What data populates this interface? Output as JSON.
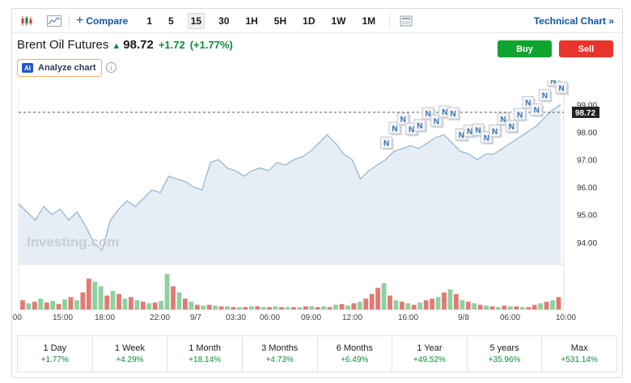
{
  "toolbar": {
    "compare_label": "Compare",
    "intervals": [
      "1",
      "5",
      "15",
      "30",
      "1H",
      "5H",
      "1D",
      "1W",
      "1M"
    ],
    "active_interval": "15",
    "technical_chart_label": "Technical Chart »"
  },
  "instrument": {
    "name": "Brent Oil Futures",
    "price": "98.72",
    "change": "+1.72",
    "change_pct": "(+1.77%)",
    "direction": "up"
  },
  "actions": {
    "buy_label": "Buy",
    "sell_label": "Sell"
  },
  "analyze": {
    "badge": "AI",
    "label": "Analyze chart",
    "info": "i"
  },
  "colors": {
    "up": "#0e8a3a",
    "buy": "#0fa430",
    "sell": "#e8352b",
    "link": "#1256a0",
    "line": "#8fb3d1",
    "area": "#e3ecf4"
  },
  "chart_data": {
    "type": "area",
    "y_ticks": [
      "99.00",
      "98.00",
      "97.00",
      "96.00",
      "95.00",
      "94.00"
    ],
    "ylim": [
      93.2,
      99.6
    ],
    "current_price_label": "98.72",
    "current_price": 98.72,
    "x_ticks": [
      ":00",
      "15:00",
      "18:00",
      "22:00",
      "9/7",
      "03:30",
      "06:00",
      "09:00",
      "12:00",
      "16:00",
      "9/8",
      "06:00",
      "10:00"
    ],
    "watermark": "Investing.com",
    "news_marker_label": "N",
    "news_marker_count": 22,
    "price_series": [
      95.4,
      95.1,
      94.8,
      95.3,
      95.0,
      95.2,
      94.8,
      95.1,
      94.6,
      94.0,
      93.7,
      94.8,
      95.2,
      95.5,
      95.3,
      95.6,
      95.9,
      95.8,
      96.4,
      96.3,
      96.2,
      96.0,
      95.9,
      96.9,
      97.0,
      96.7,
      96.6,
      96.4,
      96.6,
      96.7,
      96.6,
      96.9,
      96.8,
      97.0,
      97.1,
      97.3,
      97.6,
      97.9,
      97.6,
      97.2,
      97.0,
      96.3,
      96.6,
      96.8,
      97.0,
      97.3,
      97.4,
      97.5,
      97.4,
      97.6,
      97.8,
      97.9,
      97.6,
      97.3,
      97.2,
      97.0,
      97.2,
      97.2,
      97.4,
      97.6,
      97.8,
      98.0,
      98.2,
      98.5,
      98.8,
      99.0
    ],
    "volume_series": [
      12,
      8,
      10,
      14,
      9,
      11,
      7,
      13,
      16,
      12,
      22,
      40,
      36,
      30,
      18,
      24,
      20,
      14,
      16,
      12,
      10,
      8,
      9,
      11,
      46,
      30,
      22,
      14,
      10,
      6,
      5,
      6,
      5,
      4,
      4,
      3,
      3,
      3,
      4,
      4,
      3,
      3,
      4,
      3,
      3,
      3,
      3,
      4,
      4,
      3,
      4,
      3,
      6,
      7,
      5,
      8,
      10,
      14,
      20,
      28,
      34,
      18,
      12,
      10,
      8,
      6,
      9,
      12,
      14,
      16,
      22,
      26,
      20,
      12,
      10,
      8,
      6,
      5,
      4,
      3,
      5,
      4,
      4,
      3,
      3,
      6,
      8,
      10,
      12,
      16
    ],
    "volume_up": [
      false,
      true,
      false,
      true,
      false,
      true,
      false,
      true,
      false,
      true,
      false,
      false,
      true,
      true,
      false,
      true,
      false,
      true,
      false,
      true,
      false,
      true,
      false,
      true,
      true,
      false,
      true,
      false,
      true,
      false,
      true,
      false,
      true,
      false,
      true,
      false,
      true,
      false,
      true,
      false,
      true,
      false,
      true,
      false,
      true,
      false,
      true,
      false,
      true,
      false,
      true,
      false,
      true,
      false,
      true,
      false,
      true,
      false,
      false,
      false,
      true,
      false,
      true,
      false,
      true,
      false,
      true,
      false,
      false,
      true,
      false,
      true,
      false,
      true,
      false,
      true,
      false,
      true,
      false,
      true,
      false,
      true,
      false,
      true,
      false,
      false,
      true,
      false,
      true,
      false
    ]
  },
  "periods": [
    {
      "label": "1 Day",
      "value": "+1.77%"
    },
    {
      "label": "1 Week",
      "value": "+4.29%"
    },
    {
      "label": "1 Month",
      "value": "+18.14%"
    },
    {
      "label": "3 Months",
      "value": "+4.73%"
    },
    {
      "label": "6 Months",
      "value": "+6.49%"
    },
    {
      "label": "1 Year",
      "value": "+49.52%"
    },
    {
      "label": "5 years",
      "value": "+35.96%"
    },
    {
      "label": "Max",
      "value": "+531.14%"
    }
  ]
}
